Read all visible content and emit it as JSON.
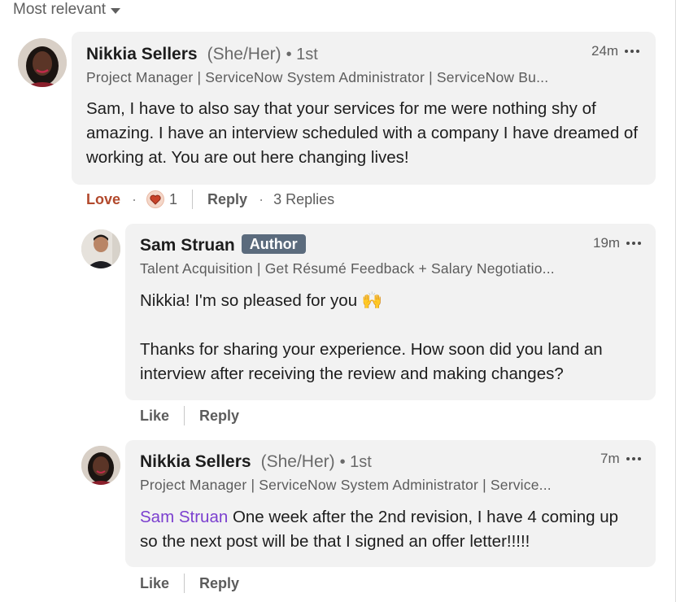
{
  "sort": {
    "label": "Most relevant"
  },
  "comments": [
    {
      "author": "Nikkia Sellers",
      "pronouns": "(She/Her)",
      "degree": "• 1st",
      "headline": "Project Manager | ServiceNow System Administrator | ServiceNow Bu...",
      "time": "24m",
      "body": "Sam, I have to also say that your services for me were nothing shy of amazing. I have an interview scheduled with a company I have dreamed of working at. You are out here changing lives!",
      "actions": {
        "reaction": "Love",
        "reaction_count": "1",
        "reply": "Reply",
        "replies": "3 Replies"
      }
    }
  ],
  "replies": [
    {
      "author": "Sam Struan",
      "badge": "Author",
      "headline": "Talent Acquisition | Get Résumé Feedback + Salary Negotiatio...",
      "time": "19m",
      "body_line1": "Nikkia! I'm so pleased for you 🙌",
      "body_line2": "Thanks for sharing your experience. How soon did you land an interview after receiving the review and making changes?",
      "actions": {
        "like": "Like",
        "reply": "Reply"
      }
    },
    {
      "author": "Nikkia Sellers",
      "pronouns": "(She/Her)",
      "degree": "• 1st",
      "headline": "Project Manager | ServiceNow System Administrator | Service...",
      "time": "7m",
      "mention": "Sam Struan",
      "body": "One week after the 2nd revision, I have 4 coming up so the next post will be that I signed an offer letter!!!!!",
      "actions": {
        "like": "Like",
        "reply": "Reply"
      }
    }
  ],
  "colors": {
    "bubble": "#f2f2f2",
    "love": "#b2492c",
    "mention": "#7b3fcf",
    "badge": "#5b6b7d"
  },
  "icons": [
    "caret-down-icon",
    "more-options-icon",
    "love-reaction-icon"
  ]
}
